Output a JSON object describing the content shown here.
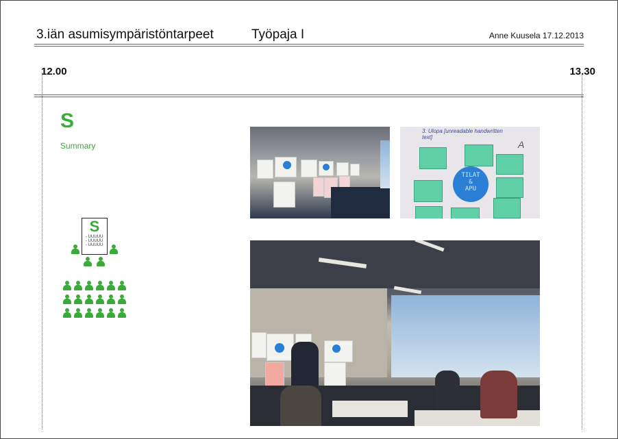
{
  "header": {
    "title": "3.iän asumisympäristöntarpeet",
    "workshop": "Työpaja I",
    "author_date": "Anne Kuusela 17.12.2013"
  },
  "timeline": {
    "start": "12.00",
    "end": "13.30"
  },
  "section": {
    "letter": "S",
    "label": "Summary"
  },
  "slide_icon": {
    "letter": "S",
    "lines": [
      "- UUUUU",
      "- UUUUU",
      "- UUUUU"
    ]
  },
  "photos": {
    "board_circle_text": "TILAT\n&\nAPU",
    "board_heading": "3. Ulopa [unreadable handwritten text]",
    "board_corner": "A"
  },
  "colors": {
    "accent": "#3aab3a",
    "note": "#5fd0a7",
    "circle": "#2a7fd4"
  }
}
